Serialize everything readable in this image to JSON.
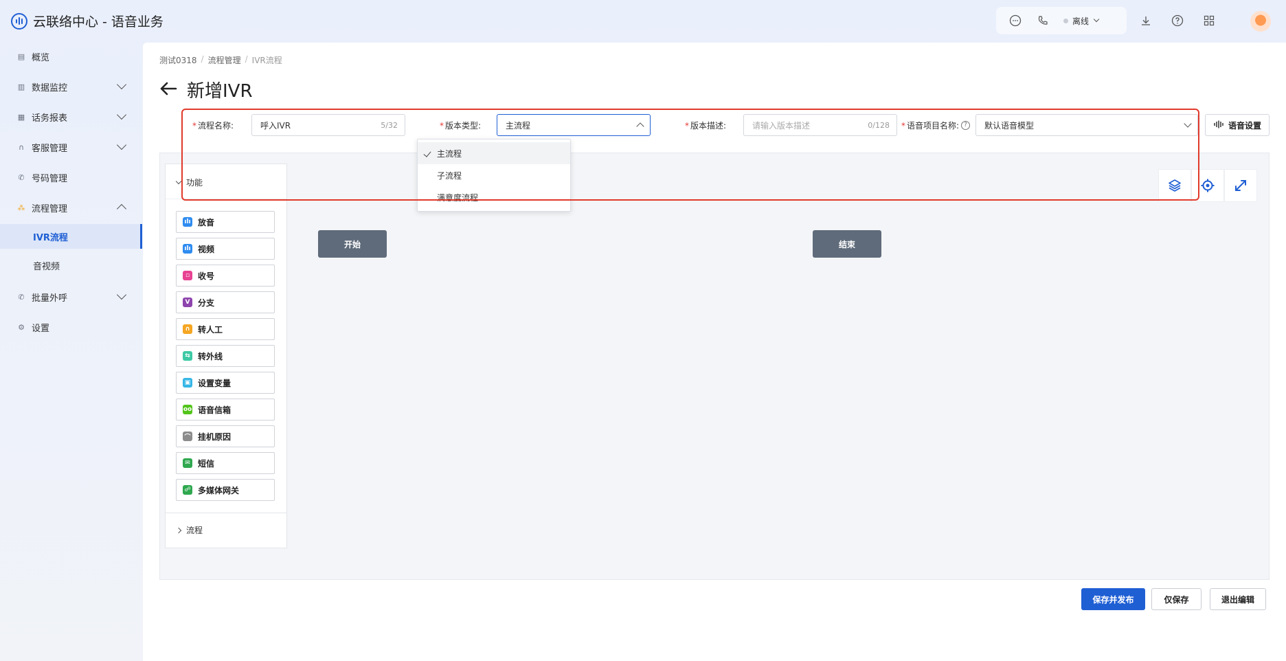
{
  "app": {
    "title": "云联络中心 - 语音业务"
  },
  "header": {
    "status": "离线",
    "icons": [
      "chat-icon",
      "phone-icon",
      "download-icon",
      "help-icon",
      "grid-icon",
      "avatar"
    ]
  },
  "sidebar": {
    "items": [
      {
        "label": "概览",
        "icon": "overview-icon"
      },
      {
        "label": "数据监控",
        "icon": "monitor-icon"
      },
      {
        "label": "话务报表",
        "icon": "report-icon"
      },
      {
        "label": "客服管理",
        "icon": "headset-icon"
      },
      {
        "label": "号码管理",
        "icon": "phone-icon"
      },
      {
        "label": "流程管理",
        "icon": "flow-icon"
      },
      {
        "label": "批量外呼",
        "icon": "outbound-icon"
      },
      {
        "label": "设置",
        "icon": "settings-icon"
      }
    ],
    "flow_sub": [
      "IVR流程",
      "音视频"
    ]
  },
  "breadcrumb": [
    "测试0318",
    "流程管理",
    "IVR流程"
  ],
  "page_title": "新增IVR",
  "form": {
    "name_label": "流程名称:",
    "name_value": "呼入IVR",
    "name_count": "5/32",
    "type_label": "版本类型:",
    "type_value": "主流程",
    "desc_label": "版本描述:",
    "desc_placeholder": "请输入版本描述",
    "desc_count": "0/128",
    "voice_label": "语音项目名称:",
    "voice_value": "默认语音模型",
    "voice_settings": "语音设置"
  },
  "dropdown": {
    "options": [
      "主流程",
      "子流程",
      "满意度流程"
    ],
    "selected": "主流程"
  },
  "panel": {
    "func_title": "功能",
    "flow_title": "流程",
    "items": [
      {
        "label": "放音",
        "color": "#2f8cf0"
      },
      {
        "label": "视频",
        "color": "#2f8cf0"
      },
      {
        "label": "收号",
        "color": "#e84393"
      },
      {
        "label": "分支",
        "color": "#8e44ad"
      },
      {
        "label": "转人工",
        "color": "#f5a623"
      },
      {
        "label": "转外线",
        "color": "#3cc9a4"
      },
      {
        "label": "设置变量",
        "color": "#36b6e6"
      },
      {
        "label": "语音信箱",
        "color": "#52c41a"
      },
      {
        "label": "挂机原因",
        "color": "#8c8c8c"
      },
      {
        "label": "短信",
        "color": "#2fa84f"
      },
      {
        "label": "多媒体网关",
        "color": "#2fa84f"
      }
    ]
  },
  "canvas": {
    "start": "开始",
    "end": "结束"
  },
  "actions": {
    "save_publish": "保存并发布",
    "save": "仅保存",
    "exit": "退出编辑"
  }
}
